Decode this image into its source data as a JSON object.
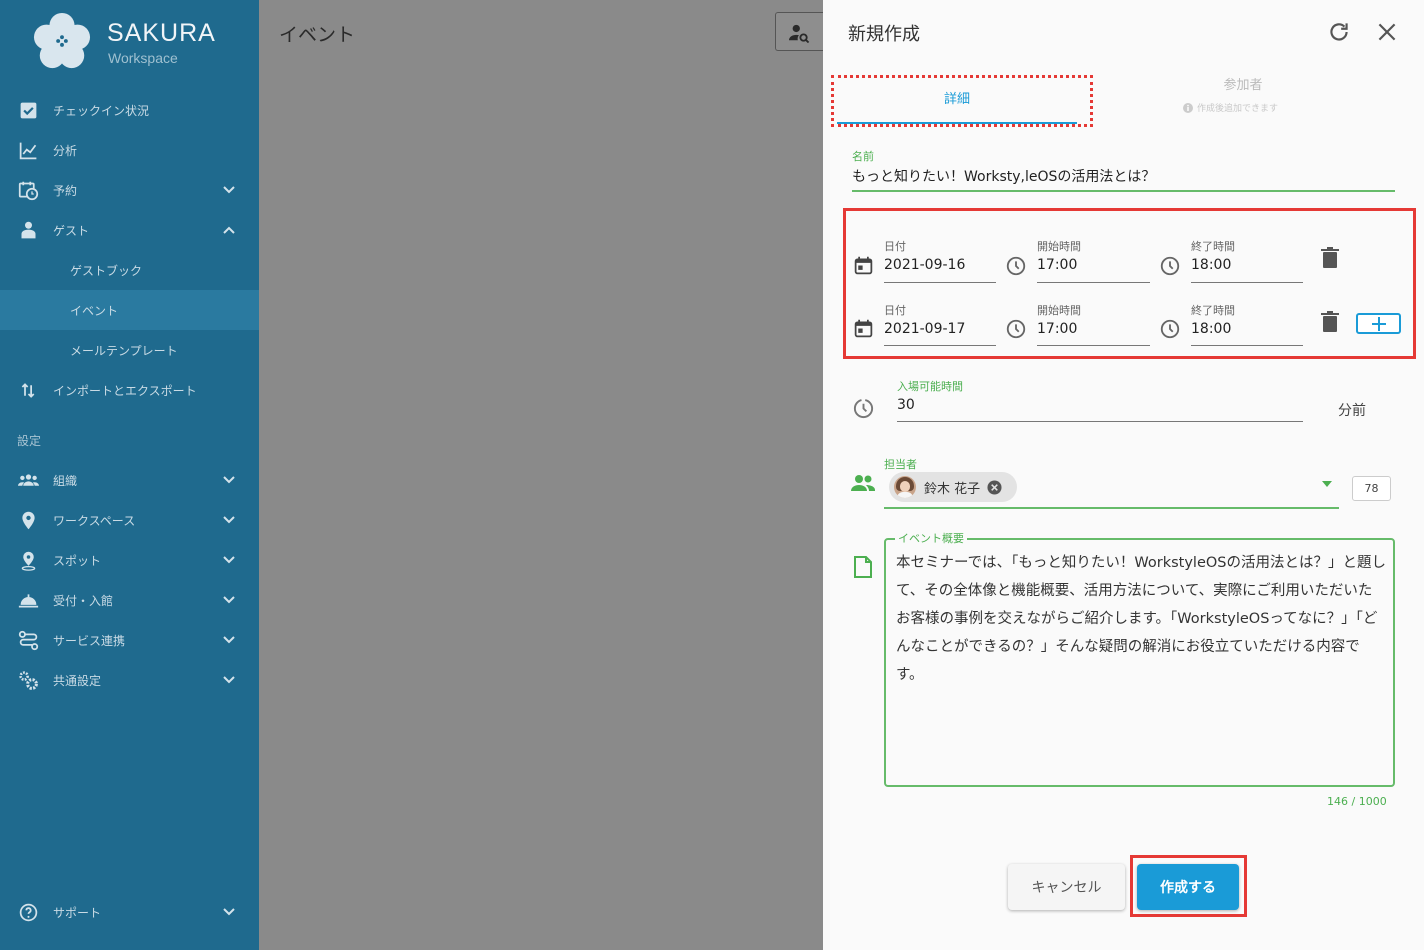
{
  "app": {
    "brand": "SAKURA",
    "brand_sub": "Workspace"
  },
  "sidebar": {
    "items": [
      {
        "label": "チェックイン状況",
        "icon": "checkbox-icon"
      },
      {
        "label": "分析",
        "icon": "chart-icon"
      },
      {
        "label": "予約",
        "icon": "calendar-clock-icon"
      },
      {
        "label": "ゲスト",
        "icon": "guest-icon"
      },
      {
        "label": "ゲストブック"
      },
      {
        "label": "イベント"
      },
      {
        "label": "メールテンプレート"
      },
      {
        "label": "インポートとエクスポート",
        "icon": "import-export-icon"
      }
    ],
    "section_settings": "設定",
    "settings_items": [
      {
        "label": "組織",
        "icon": "people-icon"
      },
      {
        "label": "ワークスペース",
        "icon": "location-pin-icon"
      },
      {
        "label": "スポット",
        "icon": "spot-pin-icon"
      },
      {
        "label": "受付・入館",
        "icon": "reception-bell-icon"
      },
      {
        "label": "サービス連携",
        "icon": "integration-icon"
      },
      {
        "label": "共通設定",
        "icon": "gears-icon"
      }
    ],
    "support": "サポート"
  },
  "main": {
    "title": "イベント"
  },
  "drawer": {
    "title": "新規作成",
    "tabs": {
      "detail": "詳細",
      "participants": "参加者",
      "participants_note": "作成後追加できます"
    },
    "name_label": "名前",
    "name_value": "もっと知りたい！Worksty,leOSの活用法とは？",
    "schedule": [
      {
        "date_label": "日付",
        "date": "2021-09-16",
        "start_label": "開始時間",
        "start": "17:00",
        "end_label": "終了時間",
        "end": "18:00"
      },
      {
        "date_label": "日付",
        "date": "2021-09-17",
        "start_label": "開始時間",
        "start": "17:00",
        "end_label": "終了時間",
        "end": "18:00"
      }
    ],
    "entry_label": "入場可能時間",
    "entry_value": "30",
    "entry_unit": "分前",
    "owner_label": "担当者",
    "owner_name": "鈴木 花子",
    "owner_count": "78",
    "summary_label": "イベント概要",
    "summary_text": "本セミナーでは、「もっと知りたい！WorkstyleOSの活用法とは？」と題して、その全体像と機能概要、活用方法について、実際にご利用いただいたお客様の事例を交えながらご紹介します。「WorkstyleOSってなに？」「どんなことができるの？」そんな疑問の解消にお役立ていただける内容です。",
    "summary_counter": "146 / 1000",
    "cancel_label": "キャンセル",
    "create_label": "作成する"
  },
  "colors": {
    "sidebar_bg": "#1f6a8e",
    "accent": "#1a9bd7",
    "green": "#4caf50",
    "highlight_red": "#e53935"
  }
}
